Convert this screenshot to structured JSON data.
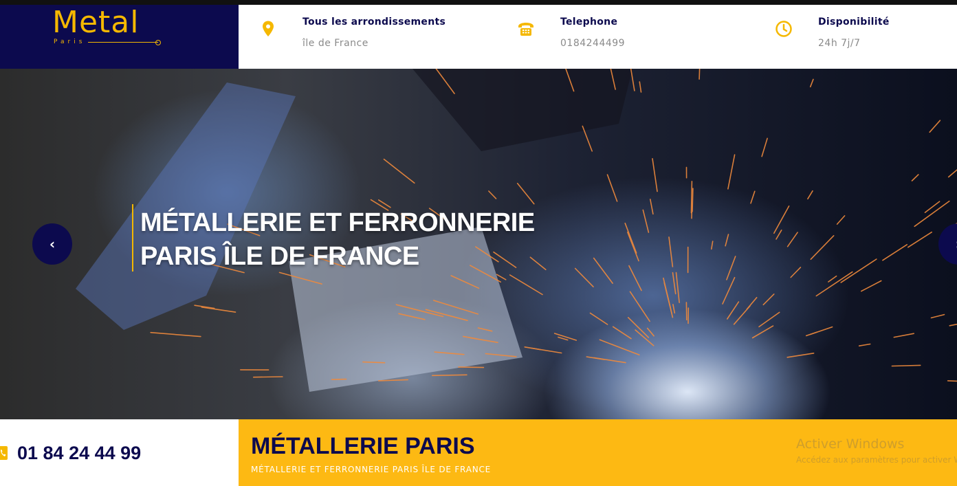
{
  "brand": {
    "logo_text": "Metal",
    "logo_subtext": "Paris"
  },
  "info": [
    {
      "title": "Tous les arrondissements",
      "subtitle": "île de France",
      "icon": "map-pin-icon"
    },
    {
      "title": "Telephone",
      "subtitle": "0184244499",
      "icon": "telephone-icon"
    },
    {
      "title": "Disponibilité",
      "subtitle": "24h 7j/7",
      "icon": "clock-icon"
    }
  ],
  "hero": {
    "title_line1": "MÉTALLERIE ET FERRONNERIE",
    "title_line2": "PARIS ÎLE DE FRANCE",
    "prev_label": "‹",
    "next_label": "›"
  },
  "cta": {
    "phone": "01 84 24 44 99",
    "title": "MÉTALLERIE PARIS",
    "subtitle": "MÉTALLERIE ET FERRONNERIE PARIS ÎLE DE FRANCE"
  },
  "watermark": {
    "title": "Activer Windows",
    "subtitle": "Accédez aux paramètres pour activer Windows."
  },
  "colors": {
    "navy": "#0c0a4e",
    "accent": "#f5b800",
    "cta_bg": "#fdb913"
  }
}
